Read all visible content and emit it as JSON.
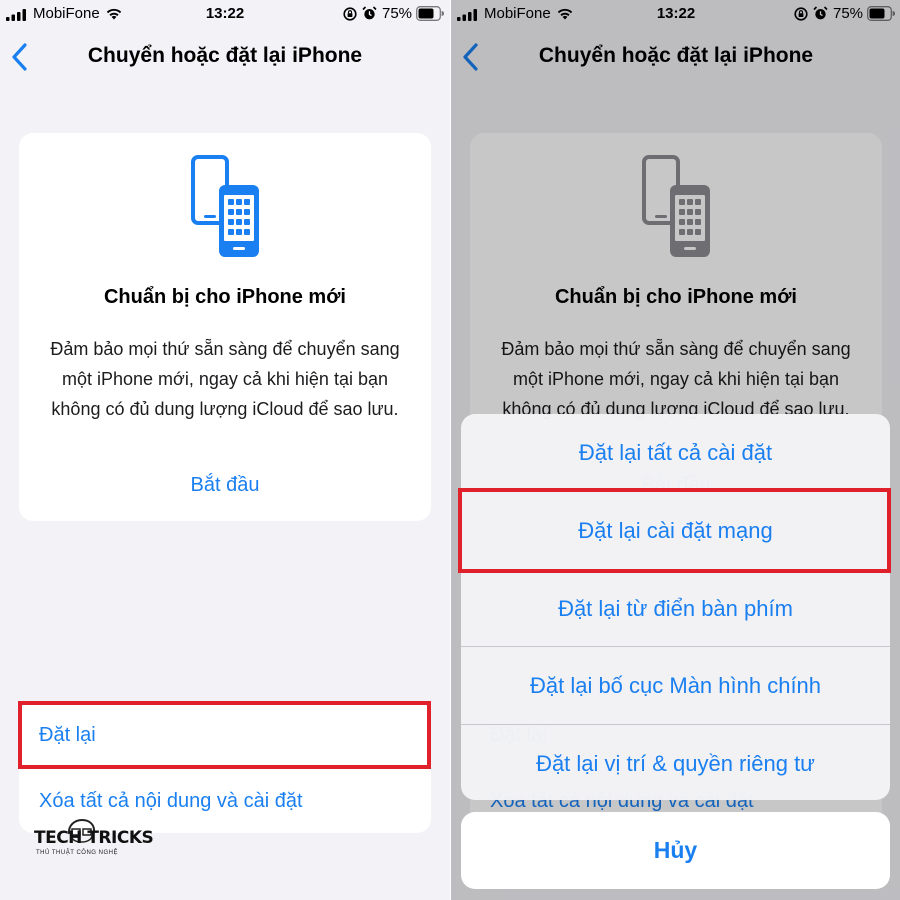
{
  "status_bar": {
    "carrier": "MobiFone",
    "time": "13:22",
    "battery_percent": "75%",
    "battery_level": 0.75
  },
  "nav": {
    "title": "Chuyển hoặc đặt lại iPhone"
  },
  "prepare_card": {
    "title": "Chuẩn bị cho iPhone mới",
    "description": "Đảm bảo mọi thứ sẵn sàng để chuyển sang một iPhone mới, ngay cả khi hiện tại bạn không có đủ dung lượng iCloud để sao lưu.",
    "action": "Bắt đầu"
  },
  "bottom_list": {
    "reset": "Đặt lại",
    "erase_all": "Xóa tất cả nội dung và cài đặt"
  },
  "action_sheet": {
    "items": [
      "Đặt lại tất cả cài đặt",
      "Đặt lại cài đặt mạng",
      "Đặt lại từ điển bàn phím",
      "Đặt lại bố cục Màn hình chính",
      "Đặt lại vị trí & quyền riêng tư"
    ],
    "cancel": "Hủy"
  },
  "watermark": {
    "title": "TECH TRICKS",
    "subtitle": "THỦ THUẬT CÔNG NGHỆ"
  },
  "colors": {
    "accent": "#1a7ff0",
    "highlight": "#e0202a",
    "background": "#f2f2f7"
  },
  "icons": {
    "back": "chevron-left-icon",
    "phones": "two-phones-icon",
    "signal": "cellular-signal-icon",
    "wifi": "wifi-icon",
    "lock": "rotation-lock-icon",
    "alarm": "alarm-icon",
    "battery": "battery-icon"
  }
}
